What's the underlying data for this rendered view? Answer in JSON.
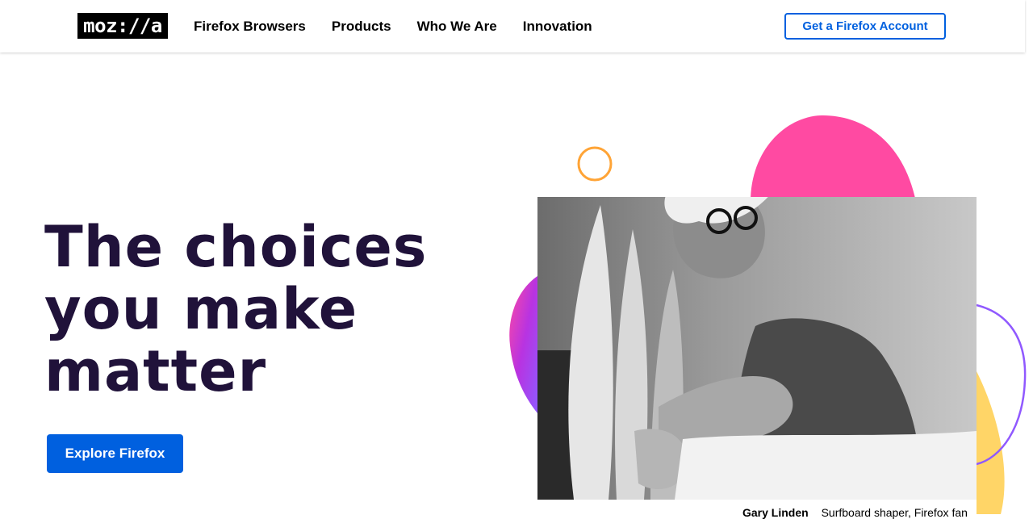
{
  "header": {
    "logo_text": "moz://a",
    "nav": [
      "Firefox Browsers",
      "Products",
      "Who We Are",
      "Innovation"
    ],
    "account_button": "Get a Firefox Account"
  },
  "hero": {
    "headline_lines": [
      "The choices",
      "you make",
      "matter"
    ],
    "cta_label": "Explore Firefox",
    "caption_name": "Gary Linden",
    "caption_role": "Surfboard shaper, Firefox fan"
  },
  "colors": {
    "primary": "#0060df",
    "ink": "#20123a",
    "pink": "#ff4aa2",
    "purple": "#b833e1",
    "violet": "#9059ff",
    "yellow": "#ffd567",
    "orange": "#ffa436"
  }
}
